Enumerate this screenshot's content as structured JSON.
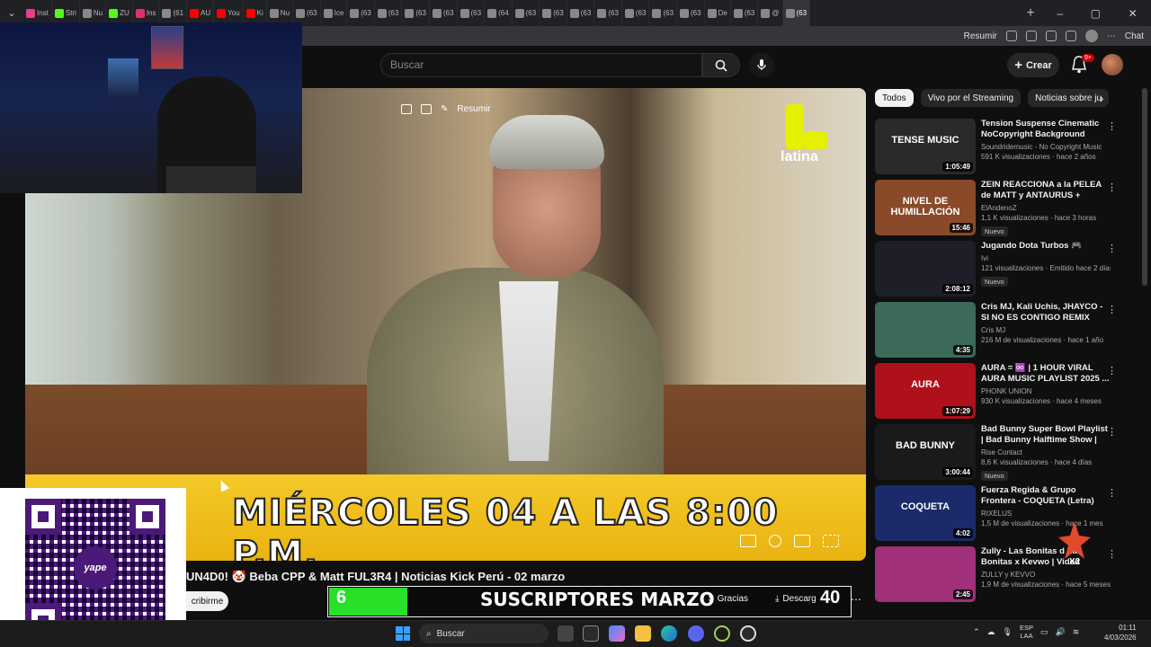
{
  "browser": {
    "tabs": [
      {
        "label": "Inst",
        "color": "#e83e8c",
        "active": false
      },
      {
        "label": "Stri",
        "color": "#53fc18",
        "active": false
      },
      {
        "label": "Nu",
        "color": "#888888",
        "active": false
      },
      {
        "label": "ZU",
        "color": "#53fc18",
        "active": false
      },
      {
        "label": "Ins",
        "color": "#e1306c",
        "active": false
      },
      {
        "label": "(61",
        "color": "#888888",
        "active": false
      },
      {
        "label": "AU",
        "color": "#ff0000",
        "active": false
      },
      {
        "label": "You",
        "color": "#ff0000",
        "active": false
      },
      {
        "label": "Ki",
        "color": "#ff0000",
        "active": false
      },
      {
        "label": "Nu",
        "color": "#888888",
        "active": false
      },
      {
        "label": "(63",
        "color": "#888888",
        "active": false
      },
      {
        "label": "Ice",
        "color": "#888888",
        "active": false
      },
      {
        "label": "(63",
        "color": "#888888",
        "active": false
      },
      {
        "label": "(63",
        "color": "#888888",
        "active": false
      },
      {
        "label": "(63",
        "color": "#888888",
        "active": false
      },
      {
        "label": "(63",
        "color": "#888888",
        "active": false
      },
      {
        "label": "(63",
        "color": "#888888",
        "active": false
      },
      {
        "label": "(64",
        "color": "#888888",
        "active": false
      },
      {
        "label": "(63",
        "color": "#888888",
        "active": false
      },
      {
        "label": "(63",
        "color": "#888888",
        "active": false
      },
      {
        "label": "(63",
        "color": "#888888",
        "active": false
      },
      {
        "label": "(63",
        "color": "#888888",
        "active": false
      },
      {
        "label": "(63",
        "color": "#888888",
        "active": false
      },
      {
        "label": "(63",
        "color": "#888888",
        "active": false
      },
      {
        "label": "(63",
        "color": "#888888",
        "active": false
      },
      {
        "label": "De",
        "color": "#888888",
        "active": false
      },
      {
        "label": "(63",
        "color": "#888888",
        "active": false
      },
      {
        "label": "@",
        "color": "#888888",
        "active": false
      },
      {
        "label": "(63",
        "color": "#888888",
        "active": true
      }
    ],
    "toolbar": {
      "resumir": "Resumir",
      "chat": "Chat"
    }
  },
  "youtube": {
    "search_placeholder": "Buscar",
    "create_label": "Crear",
    "notif_count": "9+",
    "player": {
      "resumir": "Resumir",
      "channel_logo": "latina",
      "banner_text": "MIÉRCOLES 04 A LAS 8:00 P.M."
    },
    "video_title": "UN4D0! 🤡 Beba CPP & Matt FUL3R4 | Noticias Kick Perú - 02 marzo",
    "subscribe_label": "cribirme",
    "thanks_label": "Gracias",
    "download_label": "Descarg",
    "chips": [
      "Todos",
      "Vivo por el Streaming",
      "Noticias sobre ju"
    ],
    "recommendations": [
      {
        "title": "Tension Suspense Cinematic NoCopyright Background Musi...",
        "channel": "Soundridemusic - No Copyright Music",
        "stats": "591 K visualizaciones · hace 2 años",
        "duration": "1:05:49",
        "badge": "",
        "thumb_text": "TENSE MUSIC",
        "thumb_color": "#2a2a2a"
      },
      {
        "title": "ZEIN REACCIONA a la PELEA de MATT y ANTAURUS + SIDERA...",
        "channel": "ElAndenoZ",
        "stats": "1,1 K visualizaciones · hace 3 horas",
        "duration": "15:46",
        "badge": "Nuevo",
        "thumb_text": "NIVEL DE HUMILLACIÓN",
        "thumb_color": "#8a4a2a"
      },
      {
        "title": "Jugando Dota Turbos 🎮",
        "channel": "Ivi",
        "stats": "121 visualizaciones · Emitido hace 2 días",
        "duration": "2:08:12",
        "badge": "Nuevo",
        "thumb_text": "",
        "thumb_color": "#1e1e28"
      },
      {
        "title": "Cris MJ, Kali Uchis, JHAYCO - SI NO ES CONTIGO REMIX",
        "channel": "Cris MJ",
        "stats": "216 M de visualizaciones · hace 1 año",
        "duration": "4:35",
        "badge": "",
        "thumb_text": "",
        "thumb_color": "#3c6a5a"
      },
      {
        "title": "AURA = ♾️ | 1 HOUR VIRAL AURA MUSIC PLAYLIST 2025 ...",
        "channel": "PHONK UNION",
        "stats": "930 K visualizaciones · hace 4 meses",
        "duration": "1:07:29",
        "badge": "",
        "thumb_text": "AURA",
        "thumb_color": "#b0101a"
      },
      {
        "title": "Bad Bunny Super Bowl Playlist | Bad Bunny Halftime Show | Ba...",
        "channel": "Rise Contact",
        "stats": "8,6 K visualizaciones · hace 4 días",
        "duration": "3:00:44",
        "badge": "Nuevo",
        "thumb_text": "BAD BUNNY",
        "thumb_color": "#1a1a1a"
      },
      {
        "title": "Fuerza Regida & Grupo Frontera - COQUETA (Letra)",
        "channel": "RIXELUS",
        "stats": "1,5 M de visualizaciones · hace 1 mes",
        "duration": "4:02",
        "badge": "",
        "thumb_text": "COQUETA",
        "thumb_color": "#1a2a6a"
      },
      {
        "title": "Zully - Las Bonitas d Las Bonitas x Kevwo | Video",
        "channel": "ZULLY y KEVVO",
        "stats": "1,9 M de visualizaciones · hace 5 meses",
        "duration": "2:45",
        "badge": "",
        "thumb_text": "",
        "thumb_color": "#a0307a"
      }
    ]
  },
  "overlays": {
    "subs_current": "6",
    "subs_goal": "40",
    "subs_label": "SUSCRIPTORES MARZO",
    "subs_progress": 0.15,
    "qr_logo": "yape"
  },
  "taskbar": {
    "search_label": "Buscar",
    "lang_top": "ESP",
    "lang_bottom": "LAA",
    "time": "01:11",
    "date": "4/03/2026"
  }
}
